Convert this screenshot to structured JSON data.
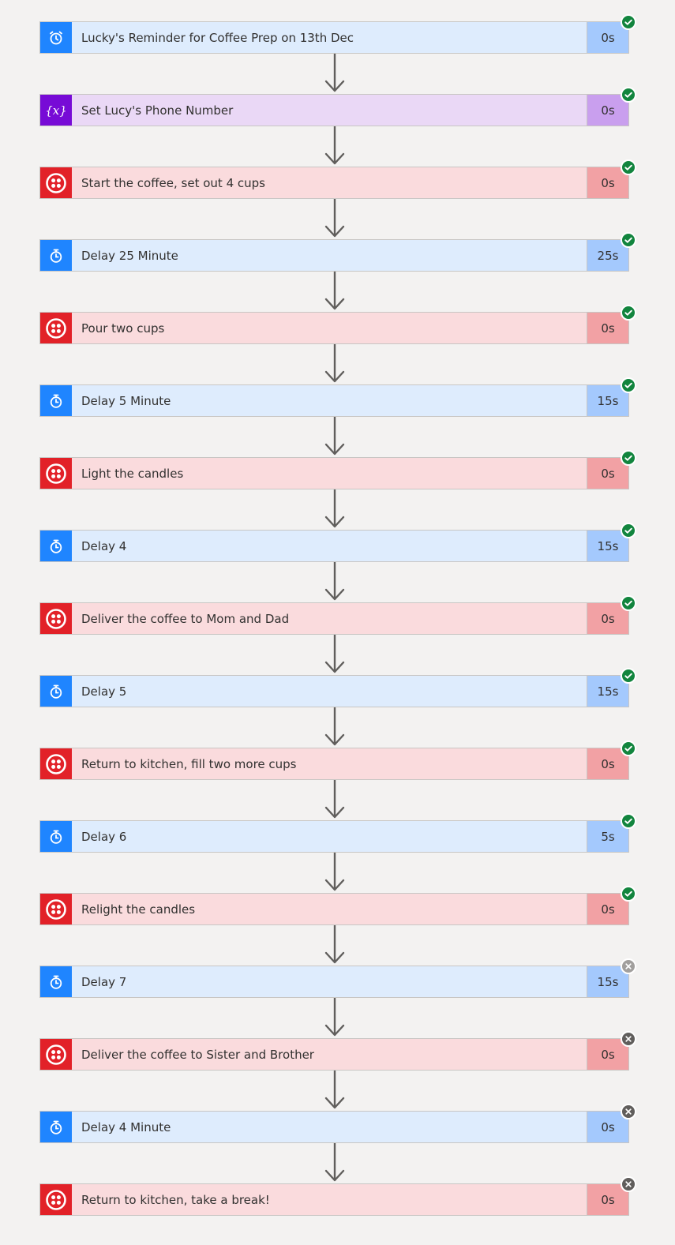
{
  "flow": {
    "steps": [
      {
        "title": "Lucky's Reminder for Coffee Prep on 13th Dec",
        "duration": "0s",
        "kind": "blue",
        "icon": "alarm-clock-icon",
        "status": "succeeded"
      },
      {
        "title": "Set Lucy's Phone Number",
        "duration": "0s",
        "kind": "purple",
        "icon": "variable-icon",
        "status": "succeeded"
      },
      {
        "title": "Start the coffee, set out 4 cups",
        "duration": "0s",
        "kind": "red",
        "icon": "twilio-icon",
        "status": "succeeded"
      },
      {
        "title": "Delay 25 Minute",
        "duration": "25s",
        "kind": "blue",
        "icon": "timer-icon",
        "status": "succeeded"
      },
      {
        "title": "Pour two cups",
        "duration": "0s",
        "kind": "red",
        "icon": "twilio-icon",
        "status": "succeeded"
      },
      {
        "title": "Delay 5 Minute",
        "duration": "15s",
        "kind": "blue",
        "icon": "timer-icon",
        "status": "succeeded"
      },
      {
        "title": "Light the candles",
        "duration": "0s",
        "kind": "red",
        "icon": "twilio-icon",
        "status": "succeeded"
      },
      {
        "title": "Delay 4",
        "duration": "15s",
        "kind": "blue",
        "icon": "timer-icon",
        "status": "succeeded"
      },
      {
        "title": "Deliver the coffee to Mom and Dad",
        "duration": "0s",
        "kind": "red",
        "icon": "twilio-icon",
        "status": "succeeded"
      },
      {
        "title": "Delay 5",
        "duration": "15s",
        "kind": "blue",
        "icon": "timer-icon",
        "status": "succeeded"
      },
      {
        "title": "Return to kitchen, fill two more cups",
        "duration": "0s",
        "kind": "red",
        "icon": "twilio-icon",
        "status": "succeeded"
      },
      {
        "title": "Delay 6",
        "duration": "5s",
        "kind": "blue",
        "icon": "timer-icon",
        "status": "succeeded"
      },
      {
        "title": "Relight the candles",
        "duration": "0s",
        "kind": "red",
        "icon": "twilio-icon",
        "status": "succeeded"
      },
      {
        "title": "Delay 7",
        "duration": "15s",
        "kind": "blue",
        "icon": "timer-icon",
        "status": "skipped"
      },
      {
        "title": "Deliver the coffee to Sister and Brother",
        "duration": "0s",
        "kind": "red",
        "icon": "twilio-icon",
        "status": "cancelled"
      },
      {
        "title": "Delay 4 Minute",
        "duration": "0s",
        "kind": "blue",
        "icon": "timer-icon",
        "status": "cancelled"
      },
      {
        "title": "Return to kitchen, take a break!",
        "duration": "0s",
        "kind": "red",
        "icon": "twilio-icon",
        "status": "cancelled"
      }
    ]
  },
  "colors": {
    "canvas_background": "#f3f2f1",
    "schedule_blue": "#1f85ff",
    "variable_purple": "#770bd6",
    "twilio_red": "#e22128",
    "status_succeeded": "#12853e",
    "status_skipped": "#a19f9d",
    "status_cancelled": "#605e5c",
    "connector_arrow": "#605e5c"
  }
}
